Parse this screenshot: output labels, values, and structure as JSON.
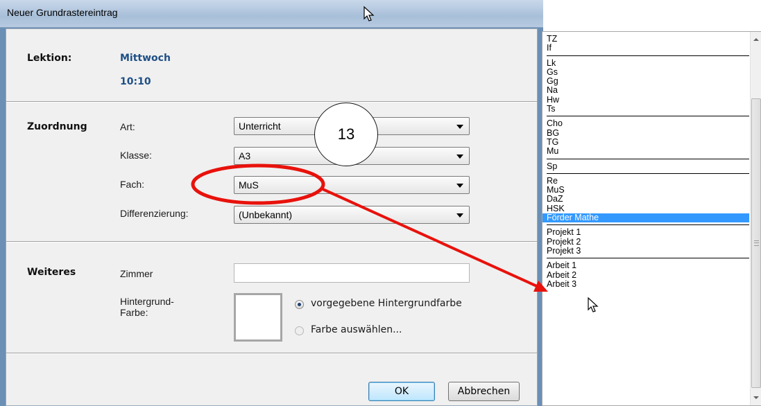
{
  "window": {
    "title": "Neuer Grundrastereintrag"
  },
  "lektion": {
    "label": "Lektion:",
    "day": "Mittwoch",
    "time": "10:10"
  },
  "zuordnung": {
    "section_label": "Zuordnung",
    "art": {
      "label": "Art:",
      "value": "Unterricht"
    },
    "klasse": {
      "label": "Klasse:",
      "value": "A3"
    },
    "fach": {
      "label": "Fach:",
      "value": "MuS"
    },
    "differenzierung": {
      "label": "Differenzierung:",
      "value": "(Unbekannt)"
    }
  },
  "weiteres": {
    "section_label": "Weiteres",
    "zimmer": {
      "label": "Zimmer",
      "value": ""
    },
    "hintergrund": {
      "label_line1": "Hintergrund-",
      "label_line2": "Farbe:",
      "option_default": "vorgegebene Hintergrundfarbe",
      "option_custom": "Farbe auswählen..."
    }
  },
  "buttons": {
    "ok": "OK",
    "cancel": "Abbrechen"
  },
  "annotation": {
    "step_number": "13",
    "color": "#e8120c"
  },
  "fach_list": {
    "items": [
      "TZ",
      "If",
      "---",
      "Lk",
      "Gs",
      "Gg",
      "Na",
      "Hw",
      "Ts",
      "---",
      "Cho",
      "BG",
      "TG",
      "Mu",
      "---",
      "Sp",
      "---",
      "Re",
      "MuS",
      "DaZ",
      "HSK",
      "Förder Mathe",
      "---",
      "Projekt 1",
      "Projekt 2",
      "Projekt 3",
      "---",
      "Arbeit 1",
      "Arbeit 2",
      "Arbeit 3"
    ],
    "selected": "Förder Mathe"
  },
  "colors": {
    "selection": "#3399ff",
    "accent_text": "#1e4f86"
  },
  "icons": {
    "cursor": "mouse-pointer-icon"
  }
}
